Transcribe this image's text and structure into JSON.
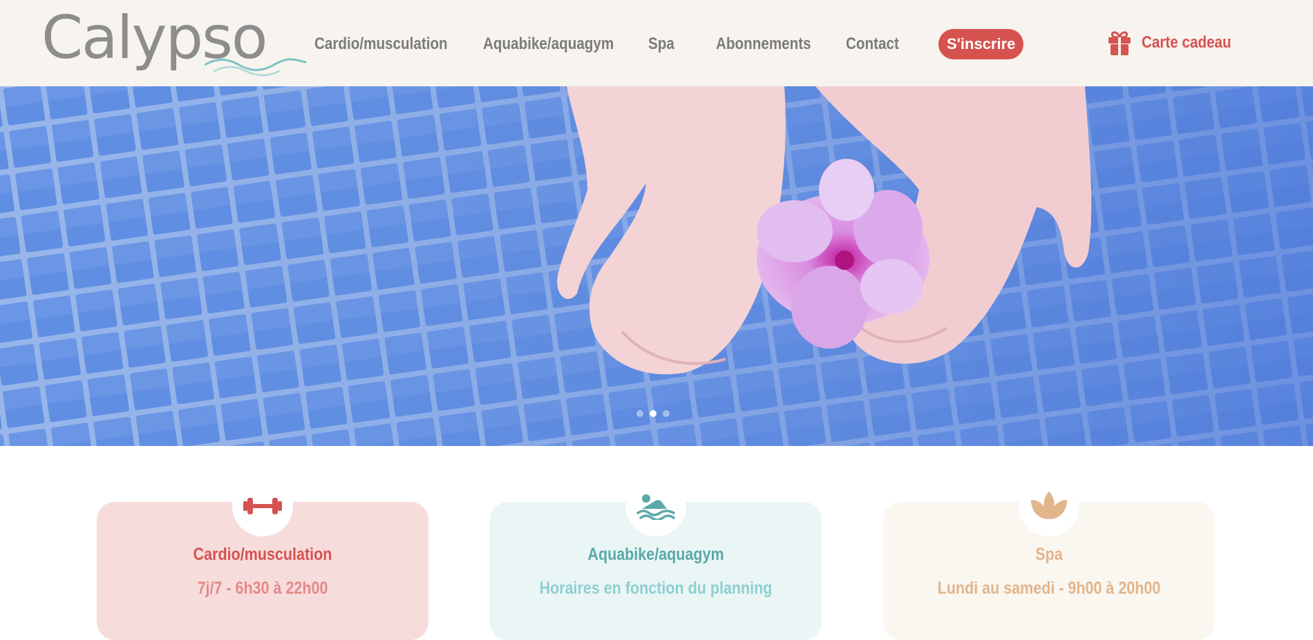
{
  "header": {
    "logo_text": "Calypso",
    "nav": [
      {
        "label": "Cardio/musculation"
      },
      {
        "label": "Aquabike/aquagym"
      },
      {
        "label": "Spa"
      },
      {
        "label": "Abonnements"
      },
      {
        "label": "Contact"
      }
    ],
    "signup_label": "S'inscrire",
    "gift_label": "Carte cadeau",
    "gift_icon": "gift-icon"
  },
  "hero": {
    "slide_count": 3,
    "active_slide": 2
  },
  "cards": [
    {
      "title": "Cardio/musculation",
      "subtitle": "7j/7 - 6h30 à 22h00",
      "icon": "dumbbell-icon"
    },
    {
      "title": "Aquabike/aquagym",
      "subtitle": "Horaires en fonction du planning",
      "icon": "swimmer-icon"
    },
    {
      "title": "Spa",
      "subtitle": "Lundi au samedi - 9h00 à 20h00",
      "icon": "lotus-icon"
    }
  ],
  "colors": {
    "header_bg": "#f7f3ee",
    "nav_text": "#7b7b7b",
    "accent_red": "#d6524f",
    "teal": "#5aa9a8",
    "sand": "#e2b58b",
    "card_red_bg": "#f7dcdc",
    "card_teal_bg": "#eaf5f5",
    "card_sand_bg": "#faf6f0"
  }
}
